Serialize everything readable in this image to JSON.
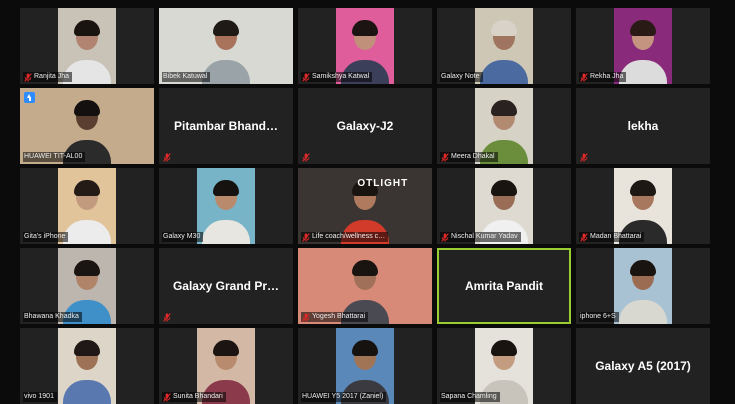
{
  "tiles": [
    {
      "type": "video",
      "label": "Ranjita Jha",
      "muted": true,
      "bg": "#c9c2b6",
      "skin": "#b08470",
      "hair": "#1a1410",
      "shirt": "#e5e5e5"
    },
    {
      "type": "video",
      "label": "Bibek Katuwal",
      "muted": false,
      "bg": "#d9d9d4",
      "skin": "#a8735a",
      "hair": "#1f1a16",
      "shirt": "#9aa3a8",
      "wide": true
    },
    {
      "type": "video",
      "label": "Samikshya Katwal",
      "muted": true,
      "bg": "#e05d9c",
      "skin": "#c0907a",
      "hair": "#1c1412",
      "shirt": "#3c3f5a"
    },
    {
      "type": "video",
      "label": "Galaxy Note",
      "muted": false,
      "bg": "#cfc7b5",
      "skin": "#a07560",
      "hair": "#d8d2c8",
      "shirt": "#4a6aa0"
    },
    {
      "type": "video",
      "label": "Rekha Jha",
      "muted": true,
      "bg": "#8a2a7a",
      "skin": "#c49480",
      "hair": "#2a1a16",
      "shirt": "#dcdcdc"
    },
    {
      "type": "video",
      "label": "HUAWEI TIT-AL00",
      "muted": false,
      "share": true,
      "bg": "#c4ab8c",
      "skin": "#5a3f30",
      "hair": "#151010",
      "shirt": "#2b2b2b",
      "wide": true
    },
    {
      "type": "name",
      "label": "",
      "display": "Pitambar  Bhand…",
      "muted": true
    },
    {
      "type": "name",
      "label": "",
      "display": "Galaxy-J2",
      "muted": true
    },
    {
      "type": "video",
      "label": "Meera Dhakal",
      "muted": true,
      "bg": "#d6d2c6",
      "skin": "#b28a70",
      "hair": "#2a2220",
      "shirt": "#6a8e3c"
    },
    {
      "type": "name",
      "label": "",
      "display": "lekha",
      "muted": true
    },
    {
      "type": "video",
      "label": "Gita's iPhone",
      "muted": false,
      "bg": "#e2c49a",
      "skin": "#c29a7e",
      "hair": "#241a16",
      "shirt": "#ececec"
    },
    {
      "type": "video",
      "label": "Galaxy M30",
      "muted": false,
      "bg": "#77b4c8",
      "skin": "#b98a6c",
      "hair": "#161210",
      "shirt": "#e8e6e0"
    },
    {
      "type": "video",
      "label": "Life coach/wellness c…",
      "muted": true,
      "bg": "#3a3532",
      "skin": "#b07a5e",
      "hair": "#1a1410",
      "shirt": "#d23a2a",
      "wide": true,
      "overlay": "OTLIGHT"
    },
    {
      "type": "video",
      "label": "Nischal Kumar Yadav",
      "muted": true,
      "bg": "#dedad2",
      "skin": "#9a6e56",
      "hair": "#1a1410",
      "shirt": "#f0f0f0"
    },
    {
      "type": "video",
      "label": "Madan  Bhattarai",
      "muted": true,
      "bg": "#e8e4dc",
      "skin": "#a8785e",
      "hair": "#1e1814",
      "shirt": "#2a2a2a"
    },
    {
      "type": "video",
      "label": "Bhawana Khadka",
      "muted": false,
      "bg": "#bcb6ae",
      "skin": "#b08468",
      "hair": "#1a1412",
      "shirt": "#3f8fc8"
    },
    {
      "type": "name",
      "label": "",
      "display": "Galaxy Grand Pr…",
      "muted": true
    },
    {
      "type": "video",
      "label": "Yogesh Bhattarai",
      "muted": true,
      "bg": "#d88a78",
      "skin": "#a07058",
      "hair": "#1a1410",
      "shirt": "#4a4a52",
      "wide": true
    },
    {
      "type": "name",
      "label": "",
      "display": "Amrita Pandit",
      "muted": false,
      "speaker": true
    },
    {
      "type": "video",
      "label": "iphone 6+S",
      "muted": false,
      "bg": "#a8c2d4",
      "skin": "#9c6c52",
      "hair": "#1a1410",
      "shirt": "#d8d8d0"
    },
    {
      "type": "video",
      "label": "vivo 1901",
      "muted": false,
      "bg": "#ddd6c8",
      "skin": "#9e7256",
      "hair": "#201816",
      "shirt": "#5a78b0"
    },
    {
      "type": "video",
      "label": "Sunita Bhandari",
      "muted": true,
      "bg": "#d4b8a6",
      "skin": "#b88a6e",
      "hair": "#1c1412",
      "shirt": "#8a3a4a"
    },
    {
      "type": "video",
      "label": "HUAWEI Y5 2017 (Zaniel)",
      "muted": false,
      "bg": "#5a88b8",
      "skin": "#a27456",
      "hair": "#161210",
      "shirt": "#3a3a40"
    },
    {
      "type": "video",
      "label": "Sapana Chamling",
      "muted": false,
      "bg": "#e4e2da",
      "skin": "#c49c80",
      "hair": "#1a1410",
      "shirt": "#c8c4bc"
    },
    {
      "type": "name",
      "label": "",
      "display": "Galaxy A5 (2017)",
      "muted": false
    }
  ],
  "colors": {
    "tile_bg": "#222222",
    "speaker_border": "#9acd32",
    "muted_icon": "#e02828",
    "share_icon": "#2d8cff"
  },
  "icons": {
    "muted": "mic-muted-icon",
    "share": "share-screen-icon"
  }
}
